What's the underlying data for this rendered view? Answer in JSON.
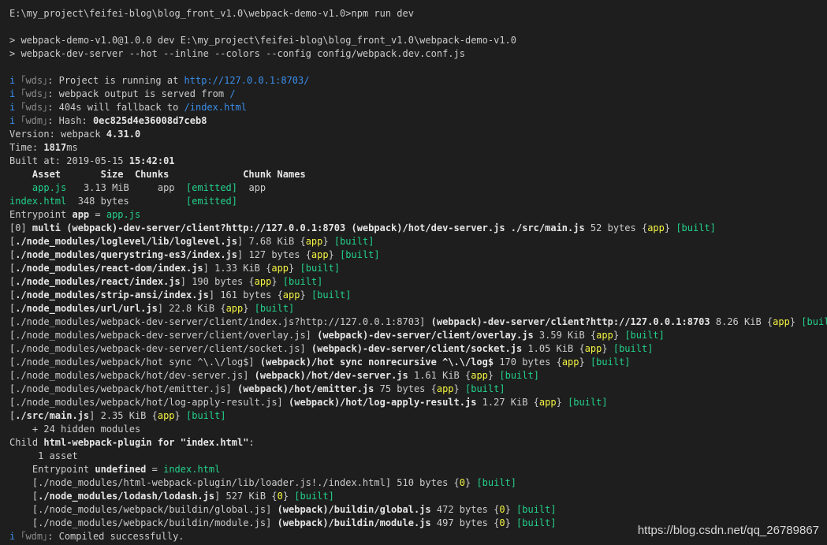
{
  "terminal": {
    "lines": [
      [
        [
          "E:\\my_project\\feifei-blog\\blog_front_v1.0\\webpack-demo-v1.0>npm run dev",
          ""
        ]
      ],
      [],
      [
        [
          "> webpack-demo-v1.0@1.0.0 dev E:\\my_project\\feifei-blog\\blog_front_v1.0\\webpack-demo-v1.0",
          ""
        ]
      ],
      [
        [
          "> webpack-dev-server --hot --inline --colors --config config/webpack.dev.conf.js",
          ""
        ]
      ],
      [],
      [
        [
          "i",
          "info"
        ],
        [
          " ｢wds｣",
          "tag"
        ],
        [
          ": Project is running at ",
          ""
        ],
        [
          "http://127.0.0.1:8703/",
          "link"
        ]
      ],
      [
        [
          "i",
          "info"
        ],
        [
          " ｢wds｣",
          "tag"
        ],
        [
          ": webpack output is served from ",
          ""
        ],
        [
          "/",
          "link"
        ]
      ],
      [
        [
          "i",
          "info"
        ],
        [
          " ｢wds｣",
          "tag"
        ],
        [
          ": 404s will fallback to ",
          ""
        ],
        [
          "/index.html",
          "link"
        ]
      ],
      [
        [
          "i",
          "info"
        ],
        [
          " ｢wdm｣",
          "tag"
        ],
        [
          ": Hash: ",
          ""
        ],
        [
          "0ec825d4e36008d7ceb8",
          "bold"
        ]
      ],
      [
        [
          "Version: webpack ",
          ""
        ],
        [
          "4.31.0",
          "bold"
        ]
      ],
      [
        [
          "Time: ",
          ""
        ],
        [
          "1817",
          "bold"
        ],
        [
          "ms",
          ""
        ]
      ],
      [
        [
          "Built at: 2019-05-15 ",
          ""
        ],
        [
          "15:42:01",
          "bold"
        ]
      ],
      [
        [
          "    Asset       Size  Chunks             Chunk Names",
          "header"
        ]
      ],
      [
        [
          "    ",
          ""
        ],
        [
          "app.js",
          "green"
        ],
        [
          "   3.13 MiB     app  ",
          ""
        ],
        [
          "[emitted]",
          "green"
        ],
        [
          "  app",
          ""
        ]
      ],
      [
        [
          "index.html",
          "green"
        ],
        [
          "  348 bytes          ",
          ""
        ],
        [
          "[emitted]",
          "green"
        ]
      ],
      [
        [
          "Entrypoint ",
          ""
        ],
        [
          "app",
          "bold"
        ],
        [
          " = ",
          ""
        ],
        [
          "app.js",
          "green"
        ]
      ],
      [
        [
          "[0] ",
          ""
        ],
        [
          "multi (webpack)-dev-server/client?http://127.0.0.1:8703 (webpack)/hot/dev-server.js ./src/main.js",
          "bold"
        ],
        [
          " 52 bytes {",
          ""
        ],
        [
          "app",
          "yellow"
        ],
        [
          "} ",
          ""
        ],
        [
          "[built]",
          "green"
        ]
      ],
      [
        [
          "[",
          ""
        ],
        [
          "./node_modules/loglevel/lib/loglevel.js",
          "bold"
        ],
        [
          "] 7.68 KiB {",
          ""
        ],
        [
          "app",
          "yellow"
        ],
        [
          "} ",
          ""
        ],
        [
          "[built]",
          "green"
        ]
      ],
      [
        [
          "[",
          ""
        ],
        [
          "./node_modules/querystring-es3/index.js",
          "bold"
        ],
        [
          "] 127 bytes {",
          ""
        ],
        [
          "app",
          "yellow"
        ],
        [
          "} ",
          ""
        ],
        [
          "[built]",
          "green"
        ]
      ],
      [
        [
          "[",
          ""
        ],
        [
          "./node_modules/react-dom/index.js",
          "bold"
        ],
        [
          "] 1.33 KiB {",
          ""
        ],
        [
          "app",
          "yellow"
        ],
        [
          "} ",
          ""
        ],
        [
          "[built]",
          "green"
        ]
      ],
      [
        [
          "[",
          ""
        ],
        [
          "./node_modules/react/index.js",
          "bold"
        ],
        [
          "] 190 bytes {",
          ""
        ],
        [
          "app",
          "yellow"
        ],
        [
          "} ",
          ""
        ],
        [
          "[built]",
          "green"
        ]
      ],
      [
        [
          "[",
          ""
        ],
        [
          "./node_modules/strip-ansi/index.js",
          "bold"
        ],
        [
          "] 161 bytes {",
          ""
        ],
        [
          "app",
          "yellow"
        ],
        [
          "} ",
          ""
        ],
        [
          "[built]",
          "green"
        ]
      ],
      [
        [
          "[",
          ""
        ],
        [
          "./node_modules/url/url.js",
          "bold"
        ],
        [
          "] 22.8 KiB {",
          ""
        ],
        [
          "app",
          "yellow"
        ],
        [
          "} ",
          ""
        ],
        [
          "[built]",
          "green"
        ]
      ],
      [
        [
          "[./node_modules/webpack-dev-server/client/index.js?http://127.0.0.1:8703] ",
          ""
        ],
        [
          "(webpack)-dev-server/client?http://127.0.0.1:8703",
          "bold"
        ],
        [
          " 8.26 KiB {",
          ""
        ],
        [
          "app",
          "yellow"
        ],
        [
          "} ",
          ""
        ],
        [
          "[built]",
          "green"
        ]
      ],
      [
        [
          "[./node_modules/webpack-dev-server/client/overlay.js] ",
          ""
        ],
        [
          "(webpack)-dev-server/client/overlay.js",
          "bold"
        ],
        [
          " 3.59 KiB {",
          ""
        ],
        [
          "app",
          "yellow"
        ],
        [
          "} ",
          ""
        ],
        [
          "[built]",
          "green"
        ]
      ],
      [
        [
          "[./node_modules/webpack-dev-server/client/socket.js] ",
          ""
        ],
        [
          "(webpack)-dev-server/client/socket.js",
          "bold"
        ],
        [
          " 1.05 KiB {",
          ""
        ],
        [
          "app",
          "yellow"
        ],
        [
          "} ",
          ""
        ],
        [
          "[built]",
          "green"
        ]
      ],
      [
        [
          "[./node_modules/webpack/hot sync ^\\.\\/log$] ",
          ""
        ],
        [
          "(webpack)/hot sync nonrecursive ^\\.\\/log$",
          "bold"
        ],
        [
          " 170 bytes {",
          ""
        ],
        [
          "app",
          "yellow"
        ],
        [
          "} ",
          ""
        ],
        [
          "[built]",
          "green"
        ]
      ],
      [
        [
          "[./node_modules/webpack/hot/dev-server.js] ",
          ""
        ],
        [
          "(webpack)/hot/dev-server.js",
          "bold"
        ],
        [
          " 1.61 KiB {",
          ""
        ],
        [
          "app",
          "yellow"
        ],
        [
          "} ",
          ""
        ],
        [
          "[built]",
          "green"
        ]
      ],
      [
        [
          "[./node_modules/webpack/hot/emitter.js] ",
          ""
        ],
        [
          "(webpack)/hot/emitter.js",
          "bold"
        ],
        [
          " 75 bytes {",
          ""
        ],
        [
          "app",
          "yellow"
        ],
        [
          "} ",
          ""
        ],
        [
          "[built]",
          "green"
        ]
      ],
      [
        [
          "[./node_modules/webpack/hot/log-apply-result.js] ",
          ""
        ],
        [
          "(webpack)/hot/log-apply-result.js",
          "bold"
        ],
        [
          " 1.27 KiB {",
          ""
        ],
        [
          "app",
          "yellow"
        ],
        [
          "} ",
          ""
        ],
        [
          "[built]",
          "green"
        ]
      ],
      [
        [
          "[",
          ""
        ],
        [
          "./src/main.js",
          "bold"
        ],
        [
          "] 2.35 KiB {",
          ""
        ],
        [
          "app",
          "yellow"
        ],
        [
          "} ",
          ""
        ],
        [
          "[built]",
          "green"
        ]
      ],
      [
        [
          "    + 24 hidden modules",
          ""
        ]
      ],
      [
        [
          "Child ",
          ""
        ],
        [
          "html-webpack-plugin for \"index.html\"",
          "bold"
        ],
        [
          ":",
          ""
        ]
      ],
      [
        [
          "     1 asset",
          ""
        ]
      ],
      [
        [
          "    Entrypoint ",
          ""
        ],
        [
          "undefined",
          "bold"
        ],
        [
          " = ",
          ""
        ],
        [
          "index.html",
          "green"
        ]
      ],
      [
        [
          "    [./node_modules/html-webpack-plugin/lib/loader.js!./index.html] 510 bytes {",
          ""
        ],
        [
          "0",
          "yellow"
        ],
        [
          "} ",
          ""
        ],
        [
          "[built]",
          "green"
        ]
      ],
      [
        [
          "    [",
          ""
        ],
        [
          "./node_modules/lodash/lodash.js",
          "bold"
        ],
        [
          "] 527 KiB {",
          ""
        ],
        [
          "0",
          "yellow"
        ],
        [
          "} ",
          ""
        ],
        [
          "[built]",
          "green"
        ]
      ],
      [
        [
          "    [./node_modules/webpack/buildin/global.js] ",
          ""
        ],
        [
          "(webpack)/buildin/global.js",
          "bold"
        ],
        [
          " 472 bytes {",
          ""
        ],
        [
          "0",
          "yellow"
        ],
        [
          "} ",
          ""
        ],
        [
          "[built]",
          "green"
        ]
      ],
      [
        [
          "    [./node_modules/webpack/buildin/module.js] ",
          ""
        ],
        [
          "(webpack)/buildin/module.js",
          "bold"
        ],
        [
          " 497 bytes {",
          ""
        ],
        [
          "0",
          "yellow"
        ],
        [
          "} ",
          ""
        ],
        [
          "[built]",
          "green"
        ]
      ],
      [
        [
          "i",
          "info"
        ],
        [
          " ｢wdm｣",
          "tag"
        ],
        [
          ": Compiled successfully.",
          ""
        ]
      ]
    ]
  },
  "watermark": "https://blog.csdn.net/qq_26789867",
  "colors": {
    "background": "#1e1e1e",
    "text": "#cccccc",
    "info": "#3b8eea",
    "green": "#23d18b",
    "yellow": "#f5f543"
  }
}
